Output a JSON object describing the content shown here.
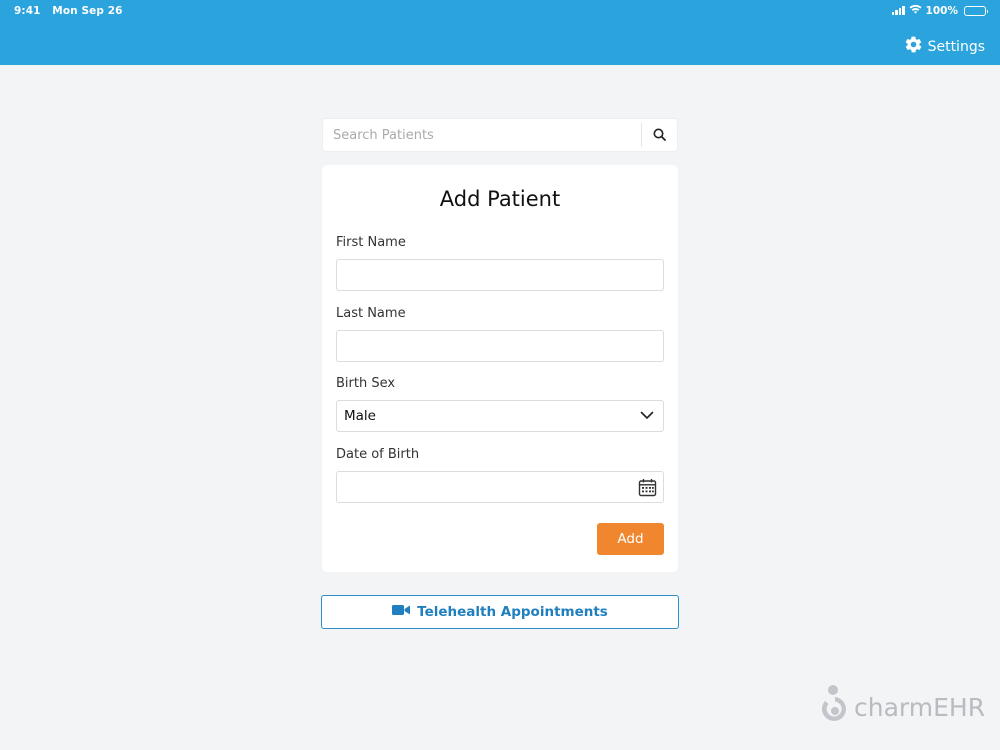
{
  "status_bar": {
    "time": "9:41",
    "date": "Mon Sep 26",
    "battery": "100%"
  },
  "header": {
    "settings_label": "Settings",
    "settings_icon": "gear-icon",
    "background": "#2ba3dc"
  },
  "search": {
    "placeholder": "Search Patients",
    "icon": "search-icon"
  },
  "form": {
    "title": "Add Patient",
    "first_name_label": "First Name",
    "first_name_value": "",
    "last_name_label": "Last Name",
    "last_name_value": "",
    "birth_sex_label": "Birth Sex",
    "birth_sex_value": "Male",
    "dob_label": "Date of Birth",
    "dob_value": "",
    "add_label": "Add",
    "add_color": "#f0862e"
  },
  "telehealth": {
    "label": "Telehealth Appointments",
    "icon": "video-camera-icon",
    "color": "#1f7fbf"
  },
  "brand": {
    "name": "charmEHR"
  }
}
